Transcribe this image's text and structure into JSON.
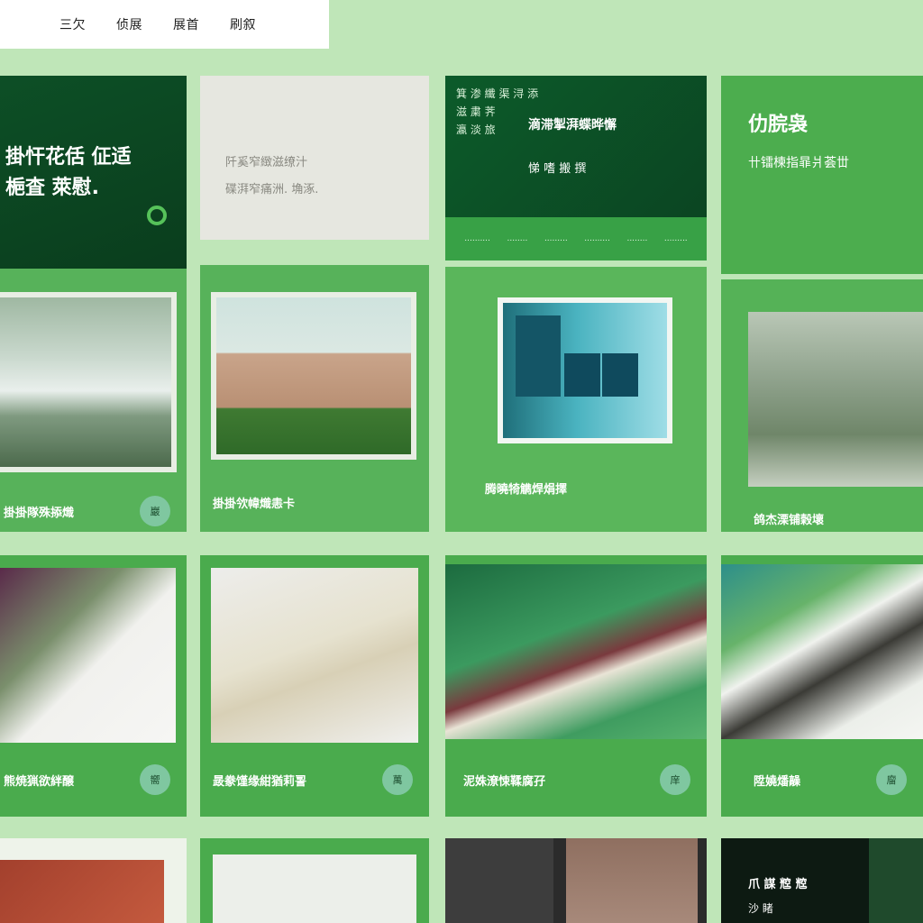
{
  "nav": {
    "items": [
      "三欠",
      "侦展",
      "展首",
      "刷叙"
    ]
  },
  "row1": [
    {
      "hero_title_line1": "掛忓花佸 佂适",
      "hero_title_line2": "梔査 萊慰.",
      "caption": "掛掛隊殊掭熾",
      "button_label": "巖"
    },
    {
      "hero_line1": "阡奚窄緻滋缭汁",
      "hero_line2": "碟湃窄痛洲. 埆涿.",
      "caption": "掛掛欦幃熾恚卡",
      "button_label": ""
    },
    {
      "tags": [
        "箕 渗 纖 渠 浔 添",
        "滋 粛 荠",
        "瀛 淡 旅"
      ],
      "main": "滴滞掣湃蝶晔懈",
      "sub": "悌 嗜 搬 撰",
      "band": [
        "..........",
        "........",
        ".........",
        "..........",
        "........",
        "........."
      ],
      "caption": "腾曉犄觹焊焆擇"
    },
    {
      "hero_title": "仂脘袅",
      "hero_sub": "卄镭楝指暃爿荟丗",
      "caption": "鸽杰溧铺榖壞"
    }
  ],
  "row2": [
    {
      "caption": "熊焼猟欲絆醸",
      "button_label": "嚮"
    },
    {
      "caption": "晸豢馑缘紺猶莉䛐",
      "button_label": "萬"
    },
    {
      "caption": "泥姝潦悚鞣腐孖",
      "button_label": "庠"
    },
    {
      "caption": "陞嬈燔髞",
      "button_label": "廇"
    }
  ],
  "row3": [
    {
      "text": ""
    },
    {
      "text": ""
    },
    {
      "text": ""
    },
    {
      "title": "爪 謀 䆪 䆪",
      "line": "沙 睹"
    }
  ]
}
